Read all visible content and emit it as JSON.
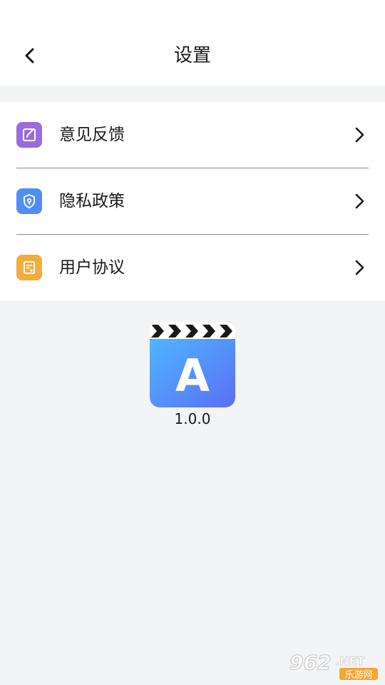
{
  "header": {
    "title": "设置",
    "back_icon": "chevron-left-icon"
  },
  "menu": {
    "items": [
      {
        "label": "意见反馈",
        "icon": "edit-icon",
        "color": "#9b6ae0"
      },
      {
        "label": "隐私政策",
        "icon": "shield-icon",
        "color": "#4f8ff5"
      },
      {
        "label": "用户协议",
        "icon": "document-icon",
        "color": "#f3ad3c"
      }
    ]
  },
  "about": {
    "logo_letter": "A",
    "version": "1.0.0"
  },
  "watermark": {
    "text_main": "962",
    "text_suffix": ".NET",
    "text_cn": "乐游网"
  }
}
